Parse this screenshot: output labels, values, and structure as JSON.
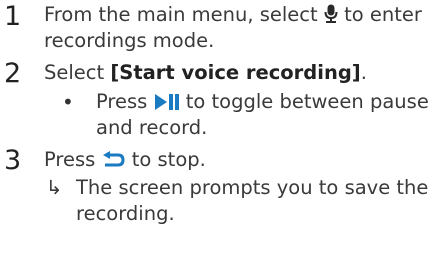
{
  "steps": [
    {
      "number": "1",
      "line1_before": "From the main menu, select",
      "line1_icon": "microphone-icon",
      "line1_after": "to enter",
      "line2": "recordings mode."
    },
    {
      "number": "2",
      "line_before": "Select ",
      "line_bold": "[Start voice recording]",
      "line_after": ".",
      "bullet_symbol": "•",
      "bullet_before": "Press",
      "bullet_icon": "play-pause-icon",
      "bullet_after": "to toggle between pause",
      "bullet_line2": "and record."
    },
    {
      "number": "3",
      "line_before": "Press",
      "line_icon": "back-arrow-icon",
      "line_after": "to stop.",
      "result_symbol": "↳",
      "result_line1": "The screen prompts you to save the",
      "result_line2": "recording."
    }
  ],
  "colors": {
    "icon_blue": "#1a7ac2",
    "text": "#3a3a3a"
  }
}
